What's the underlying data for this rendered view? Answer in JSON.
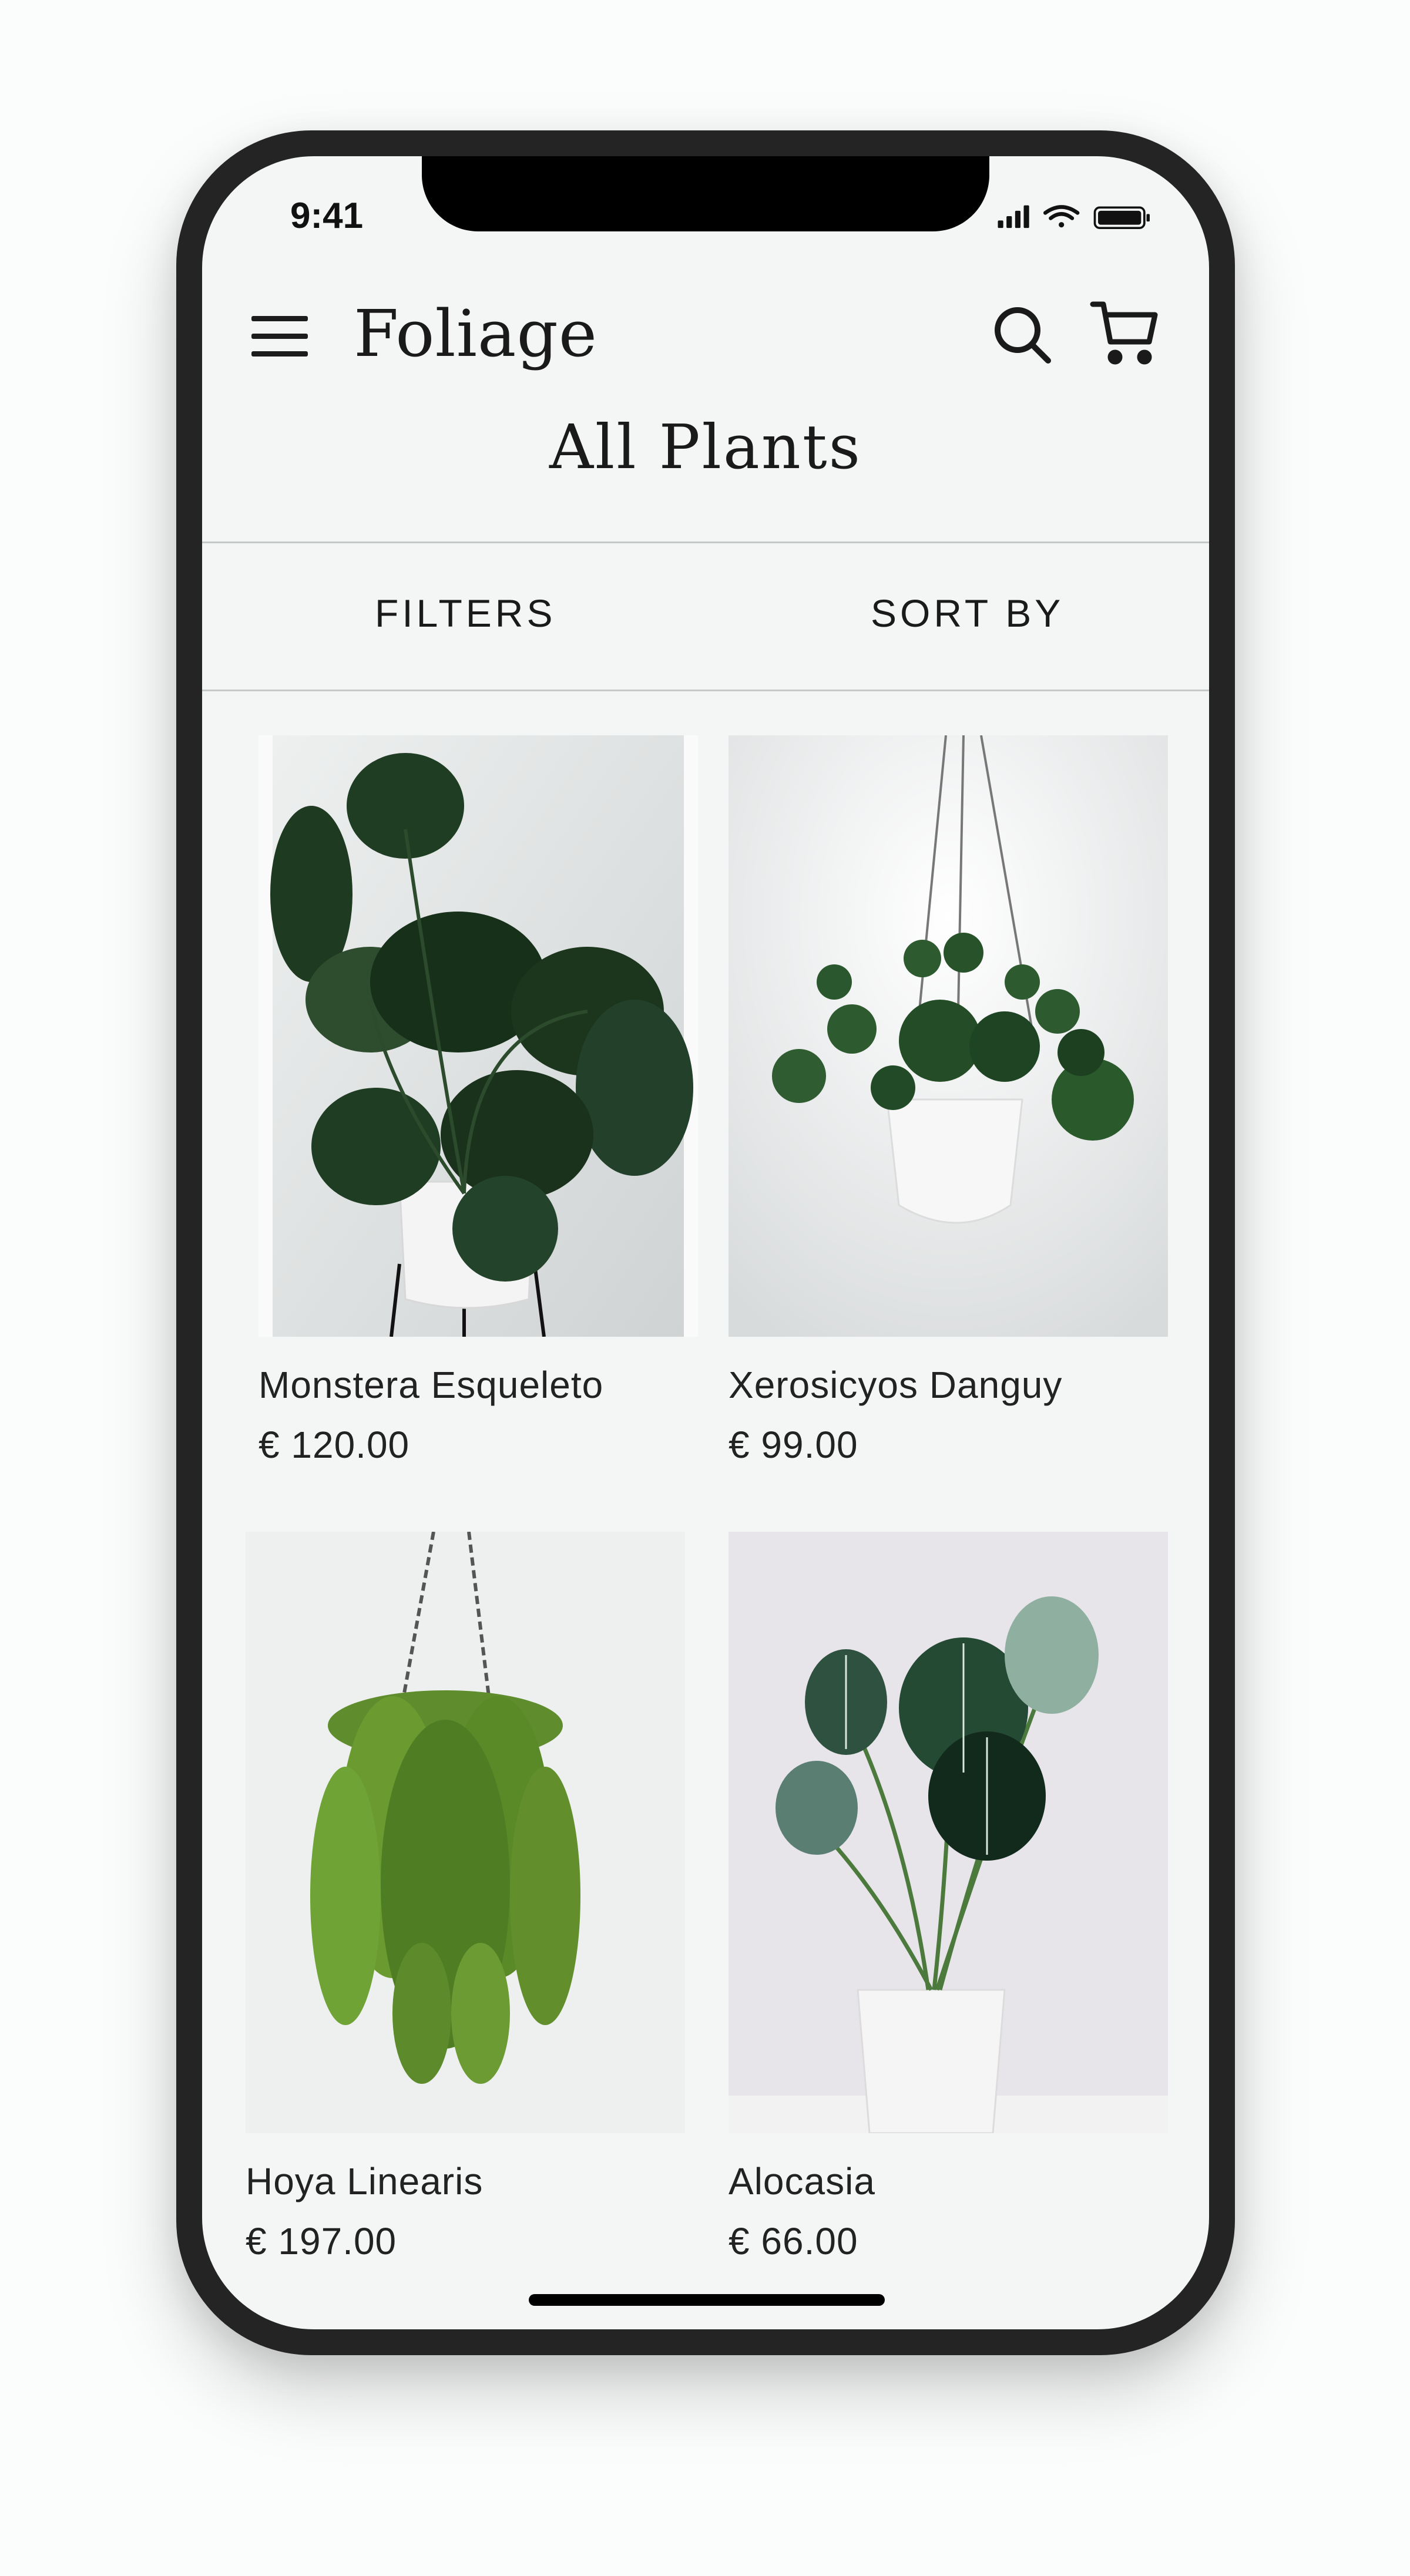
{
  "status_bar": {
    "time": "9:41"
  },
  "header": {
    "brand": "Foliage",
    "page_title": "All Plants"
  },
  "toolbar": {
    "filters": "FILTERS",
    "sort": "SORT BY"
  },
  "products": [
    {
      "name": "Monstera Esqueleto",
      "price": "€ 120.00"
    },
    {
      "name": "Xerosicyos Danguy",
      "price": "€ 99.00"
    },
    {
      "name": "Hoya Linearis",
      "price": "€ 197.00"
    },
    {
      "name": "Alocasia",
      "price": "€ 66.00"
    }
  ],
  "icons": {
    "menu": "hamburger-icon",
    "search": "search-icon",
    "cart": "cart-icon",
    "signal": "signal-icon",
    "wifi": "wifi-icon",
    "battery": "battery-icon"
  },
  "colors": {
    "background": "#f4f6f6",
    "phone_frame": "#242424",
    "text": "#1a1a1a",
    "leaf": "#1f3d23"
  }
}
